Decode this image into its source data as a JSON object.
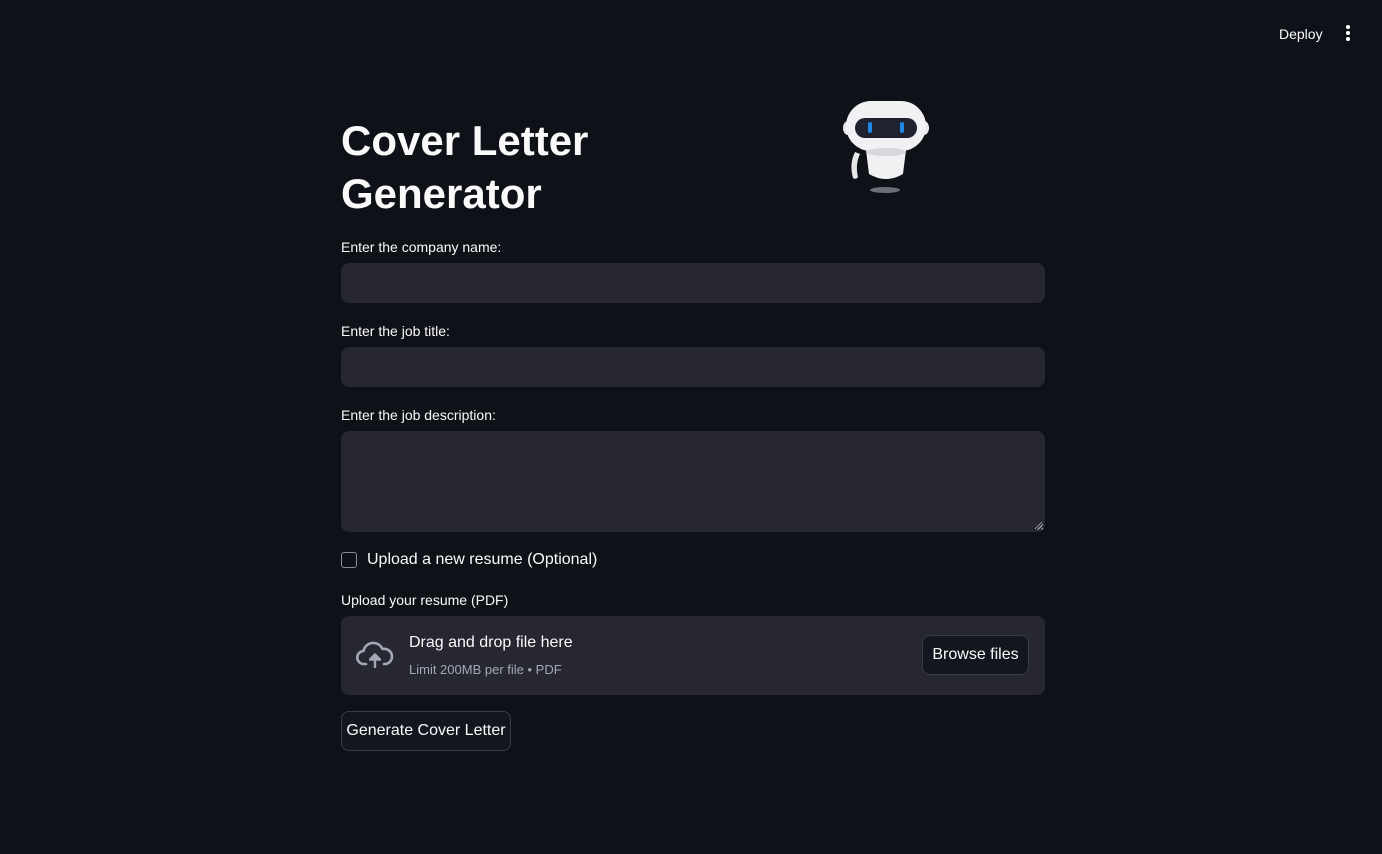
{
  "header": {
    "deploy_label": "Deploy",
    "menu_icon": "kebab-menu-icon"
  },
  "main": {
    "title": "Cover Letter Generator",
    "hero_image": "robot-icon",
    "company_field": {
      "label": "Enter the company name:",
      "value": "",
      "placeholder": ""
    },
    "job_title_field": {
      "label": "Enter the job title:",
      "value": "",
      "placeholder": ""
    },
    "job_description_field": {
      "label": "Enter the job description:",
      "value": "",
      "placeholder": ""
    },
    "upload_checkbox": {
      "label": "Upload a new resume (Optional)",
      "checked": false
    },
    "uploader": {
      "label": "Upload your resume (PDF)",
      "drop_title": "Drag and drop file here",
      "drop_subtitle": "Limit 200MB per file • PDF",
      "browse_label": "Browse files",
      "icon": "cloud-upload-icon"
    },
    "generate_label": "Generate Cover Letter"
  },
  "colors": {
    "background": "#0e1117",
    "input_bg": "#262730",
    "text": "#fafafa",
    "muted_text": "#a3a8b8",
    "accent_eyes": "#1e88e5"
  }
}
